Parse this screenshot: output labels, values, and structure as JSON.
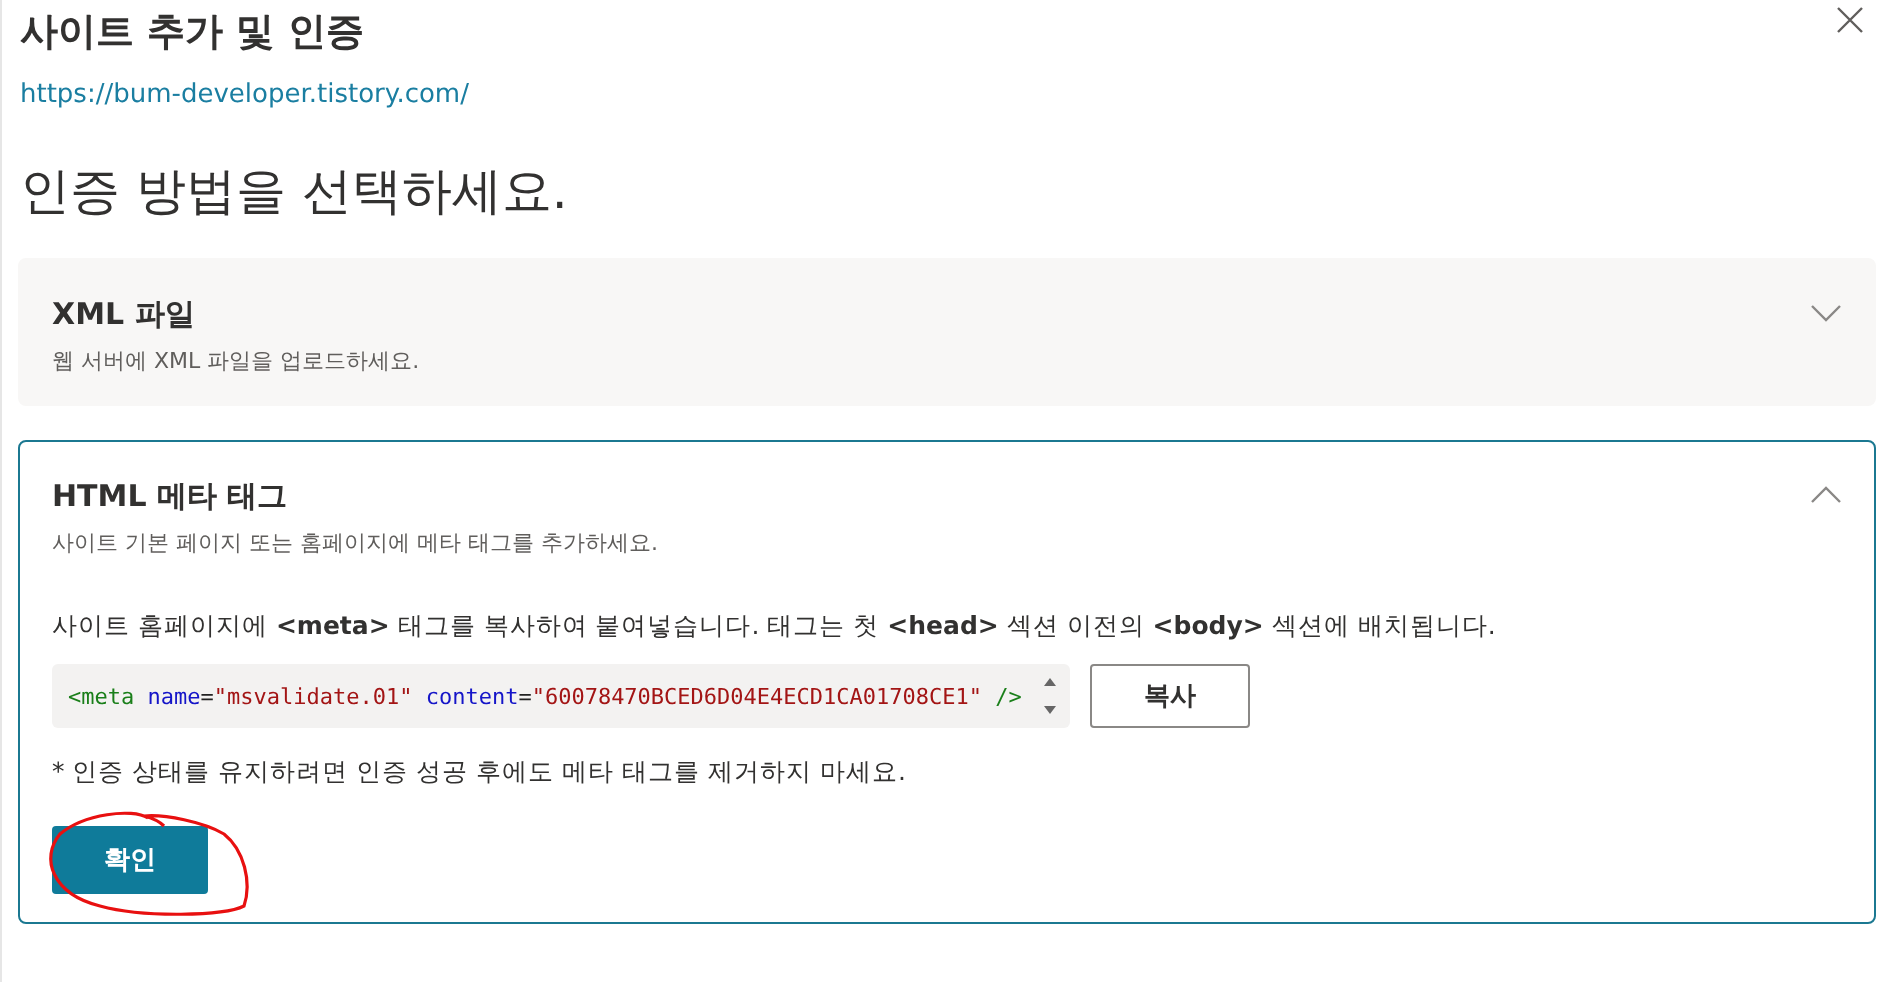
{
  "dialog": {
    "title": "사이트 추가 및 인증",
    "url": "https://bum-developer.tistory.com/",
    "heading": "인증 방법을 선택하세요."
  },
  "methods": [
    {
      "title": "XML 파일",
      "description": "웹 서버에 XML 파일을 업로드하세요.",
      "expanded": false
    },
    {
      "title": "HTML 메타 태그",
      "description": "사이트 기본 페이지 또는 홈페이지에 메타 태그를 추가하세요.",
      "expanded": true,
      "instruction": "사이트 홈페이지에 **<meta>** 태그를 복사하여 붙여넣습니다. 태그는 첫 **<head>** 섹션 이전의 **<body>** 섹션에 배치됩니다.",
      "code": [
        {
          "kind": "tag",
          "text": "<meta "
        },
        {
          "kind": "attr",
          "text": "name"
        },
        {
          "kind": "punct",
          "text": "="
        },
        {
          "kind": "value",
          "text": "\"msvalidate.01\" "
        },
        {
          "kind": "attr",
          "text": "content"
        },
        {
          "kind": "punct",
          "text": "="
        },
        {
          "kind": "value",
          "text": "\"60078470BCED6D04E4ECD1CA01708CE1\" "
        },
        {
          "kind": "tag",
          "text": "/>"
        }
      ],
      "copy_button": "복사",
      "note": "* 인증 상태를 유지하려면 인증 성공 후에도 메타 태그를 제거하지 마세요.",
      "confirm_button": "확인"
    }
  ]
}
